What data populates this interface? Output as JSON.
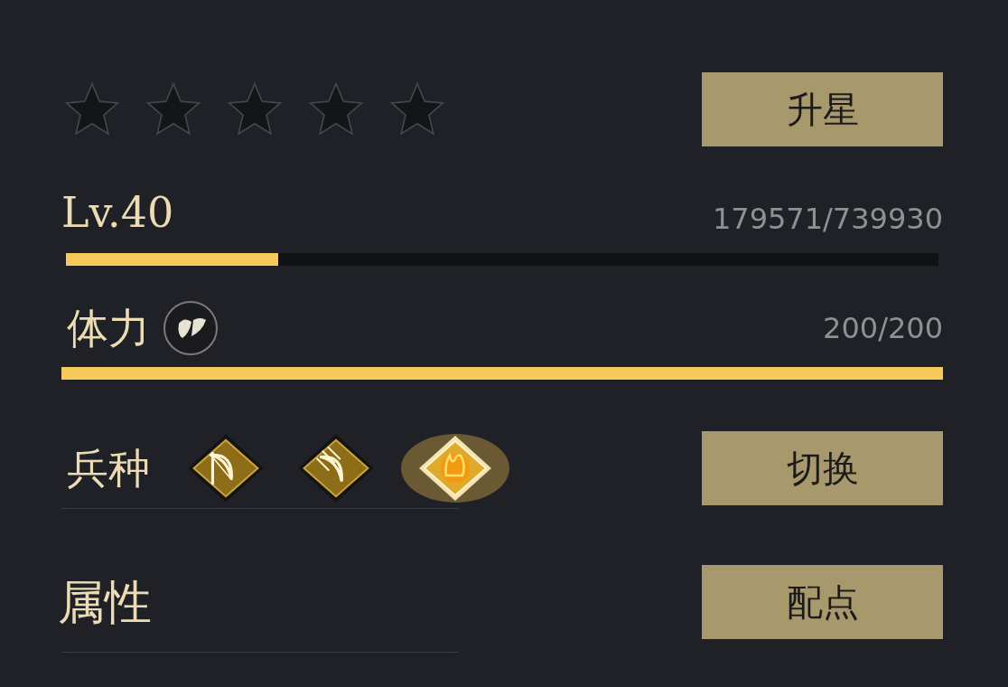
{
  "stars": 0,
  "star_button": "升星",
  "level": {
    "label": "Lv.40",
    "reading": "179571/739930",
    "level": 0.243
  },
  "stamina": {
    "label": "体力",
    "reading": "200/200",
    "level": 1
  },
  "troops": {
    "label": "兵种",
    "button": "切换",
    "items": [
      {
        "kind": "bow",
        "selected": false
      },
      {
        "kind": "multibow",
        "selected": false
      },
      {
        "kind": "flame",
        "selected": true
      }
    ]
  },
  "attributes": {
    "label": "属性",
    "button": "配点"
  }
}
